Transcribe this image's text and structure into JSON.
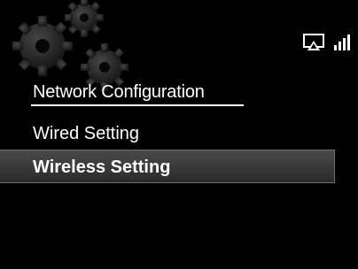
{
  "menu": {
    "title": "Network Configuration",
    "items": [
      {
        "label": "Wired Setting",
        "selected": false
      },
      {
        "label": "Wireless Setting",
        "selected": true
      }
    ]
  },
  "status": {
    "icons": [
      "airplay-icon",
      "signal-strength-icon"
    ]
  },
  "colors": {
    "background": "#000000",
    "text": "#ffffff",
    "highlight": "#3a3a3a"
  }
}
